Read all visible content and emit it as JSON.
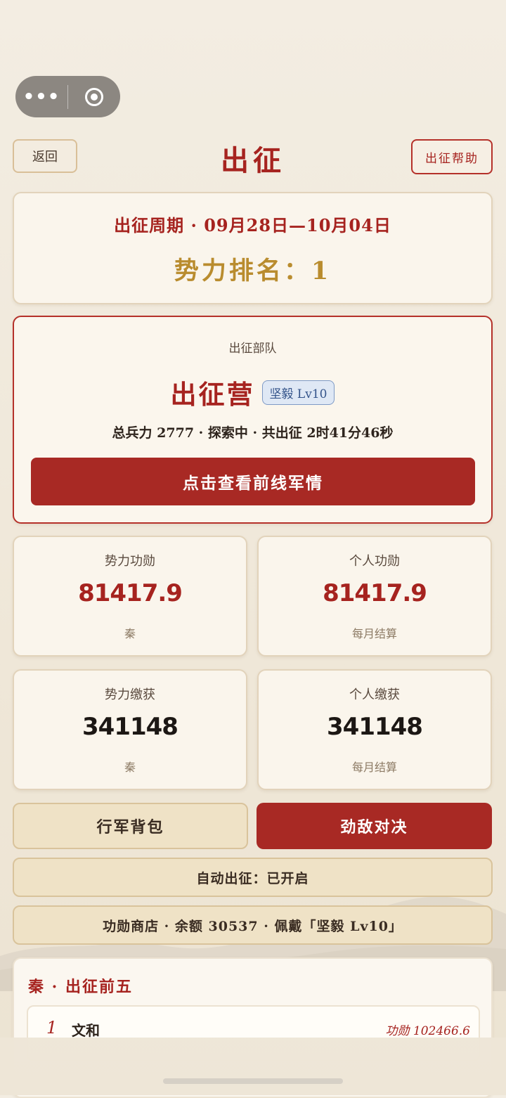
{
  "header": {
    "back_label": "返回",
    "title": "出征",
    "help_label": "出征帮助"
  },
  "period": {
    "text": "出征周期 · 09月28日—10月04日",
    "rank_text": "势力排名：1"
  },
  "troop": {
    "label": "出征部队",
    "name": "出征营",
    "badge": "坚毅 Lv10",
    "stats": "总兵力 2777 · 探索中 · 共出征 2时41分46秒",
    "frontline_label": "点击查看前线军情"
  },
  "stats": [
    {
      "label": "势力功勋",
      "value": "81417.9",
      "sub": "秦"
    },
    {
      "label": "个人功勋",
      "value": "81417.9",
      "sub": "每月结算"
    },
    {
      "label": "势力缴获",
      "value": "341148",
      "sub": "秦"
    },
    {
      "label": "个人缴获",
      "value": "341148",
      "sub": "每月结算"
    }
  ],
  "actions": {
    "bag_label": "行军背包",
    "duel_label": "劲敌对决"
  },
  "auto_march": "自动出征：已开启",
  "shop": "功勋商店 · 余额 30537 · 佩戴「坚毅 Lv10」",
  "top5": {
    "title": "秦 · 出征前五",
    "rows": [
      {
        "rank": "1",
        "name": "文和",
        "merit": "功勋 102466.6"
      }
    ]
  },
  "colors": {
    "accent_red": "#a82924",
    "gold": "#b98c2e",
    "paper": "#f3ede2"
  }
}
